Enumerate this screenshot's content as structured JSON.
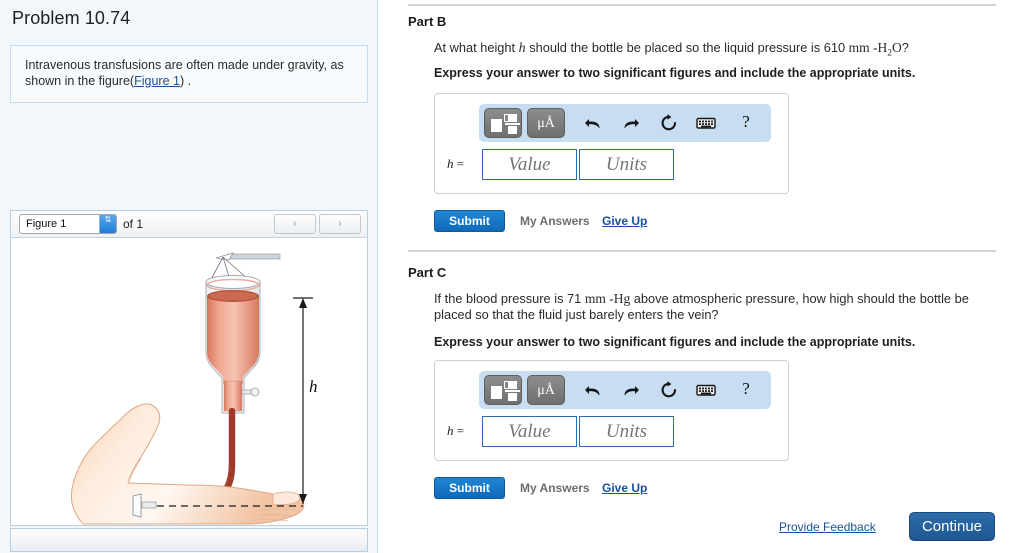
{
  "problem": {
    "title": "Problem 10.74",
    "statement_prefix": "Intravenous transfusions are often made under gravity, as shown in the figure(",
    "statement_link": "Figure 1",
    "statement_suffix": ") ."
  },
  "figure_panel": {
    "selected_figure": "Figure 1",
    "count_label": "of 1",
    "stepper_glyph": "⇅",
    "prev_glyph": "‹",
    "next_glyph": "›",
    "figure_caption": "Intravenous transfusion bottle suspended at height h above the arm vein"
  },
  "parts": [
    {
      "heading": "Part B",
      "question_a": "At what height ",
      "question_var": "h",
      "question_b": " should the bottle be placed so the liquid pressure is 610 ",
      "question_unit_mm": "mm",
      "question_unit_sep": " -",
      "question_unit_sym": "H",
      "question_unit_sub": "2",
      "question_unit_sym2": "O",
      "question_c": "?",
      "instruction": "Express your answer to two significant figures and include the appropriate units.",
      "answer": {
        "label_var": "h",
        "label_eq": "=",
        "value_placeholder": "Value",
        "units_placeholder": "Units",
        "value_current": "",
        "units_current": "",
        "toolbar": {
          "template_button": "template-tools",
          "units_button": "μÅ",
          "undo": "undo",
          "redo": "redo",
          "reset": "reset",
          "keyboard": "keyboard",
          "help": "?"
        }
      },
      "actions": {
        "submit": "Submit",
        "my_answers": "My Answers",
        "give_up": "Give Up"
      }
    },
    {
      "heading": "Part C",
      "question_a": "If the blood pressure is 71 ",
      "question_unit_mm": "mm",
      "question_unit_sep": " -",
      "question_unit_sym": "Hg",
      "question_b": " above atmospheric pressure, how high should the bottle be placed so that the fluid just barely enters the vein?",
      "instruction": "Express your answer to two significant figures and include the appropriate units.",
      "answer": {
        "label_var": "h",
        "label_eq": "=",
        "value_placeholder": "Value",
        "units_placeholder": "Units",
        "value_current": "",
        "units_current": "",
        "toolbar": {
          "template_button": "template-tools",
          "units_button": "μÅ",
          "undo": "undo",
          "redo": "redo",
          "reset": "reset",
          "keyboard": "keyboard",
          "help": "?"
        }
      },
      "actions": {
        "submit": "Submit",
        "my_answers": "My Answers",
        "give_up": "Give Up"
      }
    }
  ],
  "footer": {
    "provide_feedback": "Provide Feedback",
    "continue": "Continue"
  },
  "colors": {
    "accent_blue": "#1268b8",
    "link_blue": "#1a4f9c",
    "continue_blue": "#2e6ca8",
    "toolbar_blue": "#c6ddf2",
    "panel_bg": "#f2f7fb",
    "rule_grey": "#d2d2d2",
    "fluid_red": "#c4563f",
    "skin": "#fbe2d0"
  },
  "figure_labels": {
    "height_var": "h"
  }
}
